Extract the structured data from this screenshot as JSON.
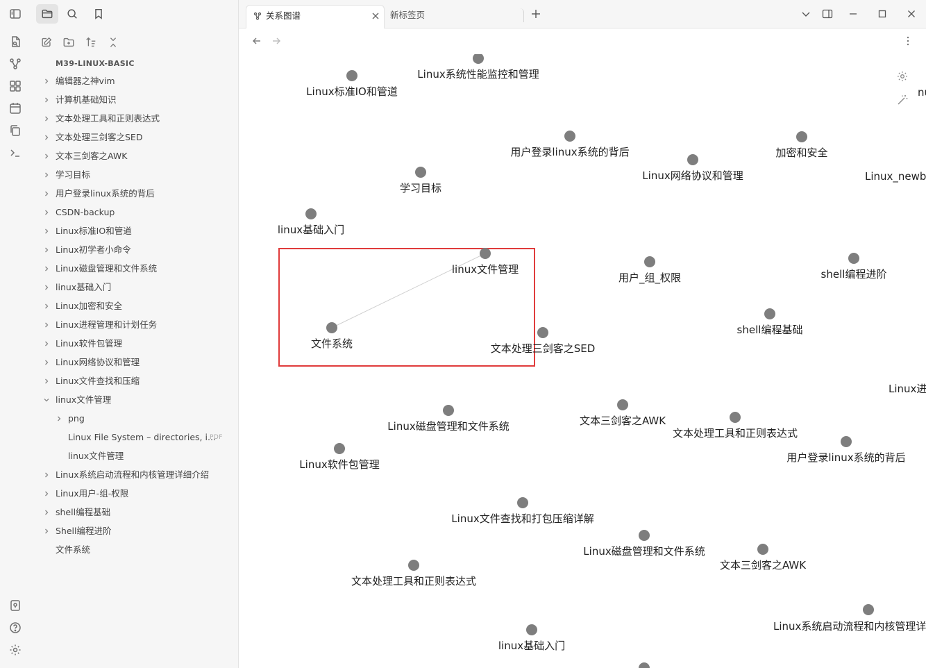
{
  "ribbon": {
    "top_icons": [
      "sidebar-toggle-icon",
      "open-quick-switcher-icon",
      "graph-view-icon",
      "canvas-icon",
      "daily-note-icon",
      "templates-icon",
      "command-palette-icon"
    ],
    "bottom_icons": [
      "vault-switch-icon",
      "help-icon",
      "settings-icon"
    ]
  },
  "sidebar": {
    "top_tabs": [
      "file-explorer-icon",
      "search-icon",
      "bookmark-icon"
    ],
    "tools": [
      "new-note-icon",
      "new-folder-icon",
      "sort-icon",
      "collapse-all-icon"
    ],
    "vault_name": "M39-LINUX-BASIC",
    "items": [
      {
        "label": "编辑器之神vim",
        "folder": true,
        "depth": 0
      },
      {
        "label": "计算机基础知识",
        "folder": true,
        "depth": 0
      },
      {
        "label": "文本处理工具和正则表达式",
        "folder": true,
        "depth": 0
      },
      {
        "label": "文本处理三剑客之SED",
        "folder": true,
        "depth": 0
      },
      {
        "label": "文本三剑客之AWK",
        "folder": true,
        "depth": 0
      },
      {
        "label": "学习目标",
        "folder": true,
        "depth": 0
      },
      {
        "label": "用户登录linux系统的背后",
        "folder": true,
        "depth": 0
      },
      {
        "label": "CSDN-backup",
        "folder": true,
        "depth": 0
      },
      {
        "label": "Linux标准IO和管道",
        "folder": true,
        "depth": 0
      },
      {
        "label": "Linux初学者小命令",
        "folder": true,
        "depth": 0
      },
      {
        "label": "Linux磁盘管理和文件系统",
        "folder": true,
        "depth": 0
      },
      {
        "label": "linux基础入门",
        "folder": true,
        "depth": 0
      },
      {
        "label": "Linux加密和安全",
        "folder": true,
        "depth": 0
      },
      {
        "label": "Linux进程管理和计划任务",
        "folder": true,
        "depth": 0
      },
      {
        "label": "Linux软件包管理",
        "folder": true,
        "depth": 0
      },
      {
        "label": "Linux网络协议和管理",
        "folder": true,
        "depth": 0
      },
      {
        "label": "Linux文件查找和压缩",
        "folder": true,
        "depth": 0
      },
      {
        "label": "linux文件管理",
        "folder": true,
        "depth": 0,
        "expanded": true
      },
      {
        "label": "png",
        "folder": true,
        "depth": 1
      },
      {
        "label": "Linux File System – directories, i...",
        "folder": false,
        "depth": 1,
        "badge": "PDF"
      },
      {
        "label": "linux文件管理",
        "folder": false,
        "depth": 1
      },
      {
        "label": "Linux系统启动流程和内核管理详细介绍",
        "folder": true,
        "depth": 0
      },
      {
        "label": "Linux用户-组-权限",
        "folder": true,
        "depth": 0
      },
      {
        "label": "shell编程基础",
        "folder": true,
        "depth": 0
      },
      {
        "label": "Shell编程进阶",
        "folder": true,
        "depth": 0
      },
      {
        "label": "文件系统",
        "folder": false,
        "depth": 0
      }
    ]
  },
  "tabs": [
    {
      "label": "关系图谱",
      "active": true,
      "icon": "graph-icon"
    },
    {
      "label": "新标签页",
      "active": false
    }
  ],
  "window_controls": [
    "tab-list-icon",
    "toggle-right-sidebar-icon",
    "minimize-icon",
    "maximize-icon",
    "close-window-icon"
  ],
  "graph": {
    "node_color": "#7e7e7e",
    "highlight_color": "#e03c3c",
    "nodes": [
      {
        "label": "Linux系统性能监控和管理"
      },
      {
        "label": "Linux标准IO和管道"
      },
      {
        "label": "用户登录linux系统的背后"
      },
      {
        "label": "加密和安全"
      },
      {
        "label": "Linux网络协议和管理"
      },
      {
        "label": "Linux_newbe"
      },
      {
        "label": "学习目标"
      },
      {
        "label": "linux基础入门"
      },
      {
        "label": "linux文件管理"
      },
      {
        "label": "用户_组_权限"
      },
      {
        "label": "shell编程进阶"
      },
      {
        "label": "文件系统"
      },
      {
        "label": "文本处理三剑客之SED"
      },
      {
        "label": "shell编程基础"
      },
      {
        "label": "Linux进"
      },
      {
        "label": "Linux磁盘管理和文件系统"
      },
      {
        "label": "文本三剑客之AWK"
      },
      {
        "label": "文本处理工具和正则表达式"
      },
      {
        "label": "用户登录linux系统的背后"
      },
      {
        "label": "Linux软件包管理"
      },
      {
        "label": "Linux文件查找和打包压缩详解"
      },
      {
        "label": "Linux磁盘管理和文件系统"
      },
      {
        "label": "文本三剑客之AWK"
      },
      {
        "label": "文本处理工具和正则表达式"
      },
      {
        "label": "Linux系统启动流程和内核管理详"
      },
      {
        "label": "linux基础入门"
      },
      {
        "label": ""
      },
      {
        "label": ""
      },
      {
        "label": "nu"
      }
    ]
  }
}
